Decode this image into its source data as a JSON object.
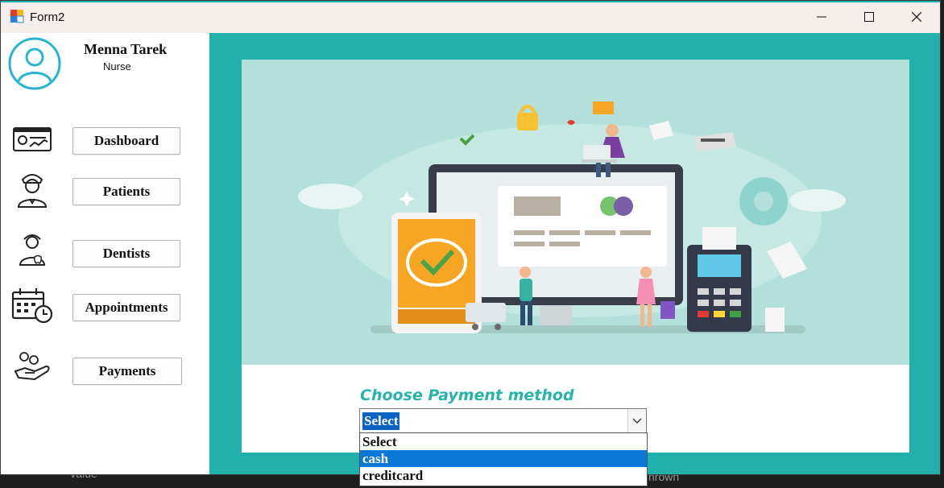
{
  "window": {
    "title": "Form2"
  },
  "background_hints": {
    "left_text": "Value",
    "right_text": "nrown"
  },
  "user": {
    "name": "Menna Tarek",
    "role": "Nurse"
  },
  "sidebar": {
    "items": [
      {
        "label": "Dashboard",
        "icon": "dashboard-icon"
      },
      {
        "label": "Patients",
        "icon": "nurse-icon"
      },
      {
        "label": "Dentists",
        "icon": "dentist-icon"
      },
      {
        "label": "Appointments",
        "icon": "calendar-clock-icon"
      },
      {
        "label": "Payments",
        "icon": "hand-coins-icon"
      }
    ]
  },
  "payment": {
    "label": "Choose Payment method",
    "selected": "Select",
    "options": [
      "Select",
      "cash",
      "creditcard"
    ],
    "highlighted_index": 1
  },
  "colors": {
    "accent": "#21b1aa",
    "illustration_bg": "#b3e0da",
    "highlight": "#0b78d7"
  }
}
